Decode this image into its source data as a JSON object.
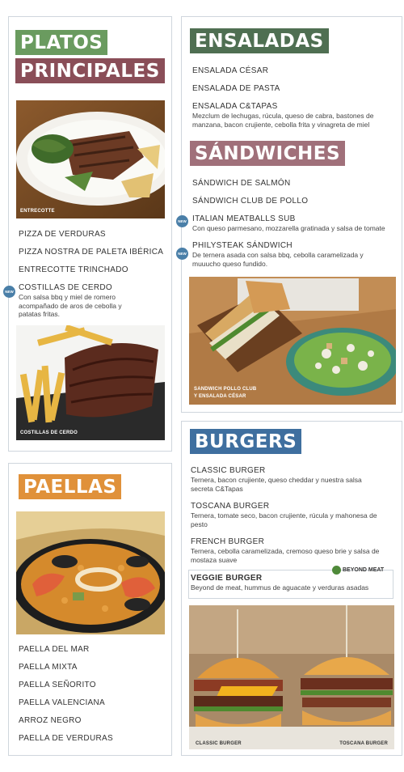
{
  "platos": {
    "banner1": "PLATOS",
    "banner2": "PRINCIPALES",
    "photo1_caption": "ENTRECOTTE",
    "items": [
      "PIZZA DE VERDURAS",
      "PIZZA NOSTRA DE PALETA IBÉRICA",
      "ENTRECOTTE TRINCHADO"
    ],
    "new_item": "COSTILLAS DE CERDO",
    "new_item_desc": "Con salsa bbq y miel de romero acompañado de aros de cebolla y patatas fritas.",
    "photo2_caption": "COSTILLAS DE CERDO"
  },
  "ensaladas": {
    "banner": "ENSALADAS",
    "items": [
      "ENSALADA CÉSAR",
      "ENSALADA DE PASTA",
      "ENSALADA C&TAPAS"
    ],
    "item3_desc": "Mezclum de lechugas, rúcula, queso de cabra, bastones de manzana, bacon crujiente, cebolla frita y vinagreta de miel"
  },
  "sandwiches": {
    "banner": "SÁNDWICHES",
    "items": [
      "SÁNDWICH DE SALMÓN",
      "SÁNDWICH CLUB DE POLLO"
    ],
    "new1": "ITALIAN MEATBALLS SUB",
    "new1_desc": "Con queso parmesano, mozzarella gratinada y salsa de tomate",
    "new2": "PHILYSTEAK SÁNDWICH",
    "new2_desc": "De ternera asada con salsa bbq, cebolla caramelizada y muuucho queso fundido.",
    "photo_caption1": "SANDWICH POLLO CLUB",
    "photo_caption2": "Y ENSALADA CÉSAR"
  },
  "paellas": {
    "banner": "PAELLAS",
    "items": [
      "PAELLA DEL MAR",
      "PAELLA MIXTA",
      "PAELLA SEÑORITO",
      "PAELLA VALENCIANA",
      "ARROZ NEGRO",
      "PAELLA DE VERDURAS"
    ]
  },
  "burgers": {
    "banner": "BURGERS",
    "items": [
      {
        "name": "CLASSIC BURGER",
        "desc": "Ternera, bacon crujiente, queso cheddar y nuestra salsa secreta C&Tapas"
      },
      {
        "name": "TOSCANA BURGER",
        "desc": "Ternera, tomate seco, bacon crujiente,  rúcula y mahonesa de pesto"
      },
      {
        "name": "FRENCH BURGER",
        "desc": "Ternera, cebolla caramelizada, cremoso queso brie y salsa de mostaza suave"
      }
    ],
    "veggie_name": "VEGGIE BURGER",
    "veggie_desc": "Beyond de meat, hummus de aguacate y verduras asadas",
    "beyond_meat": "BEYOND MEAT",
    "photo_caption1": "CLASSIC BURGER",
    "photo_caption2": "TOSCANA BURGER"
  },
  "new_badge": "NEW",
  "colors": {
    "green": "#6a9b5f",
    "maroon": "#8a4e58",
    "dark_green": "#4f6f52",
    "rose": "#a0707a",
    "orange": "#e0913a",
    "blue": "#3f6f9f",
    "new_badge": "#4a7fa8"
  }
}
